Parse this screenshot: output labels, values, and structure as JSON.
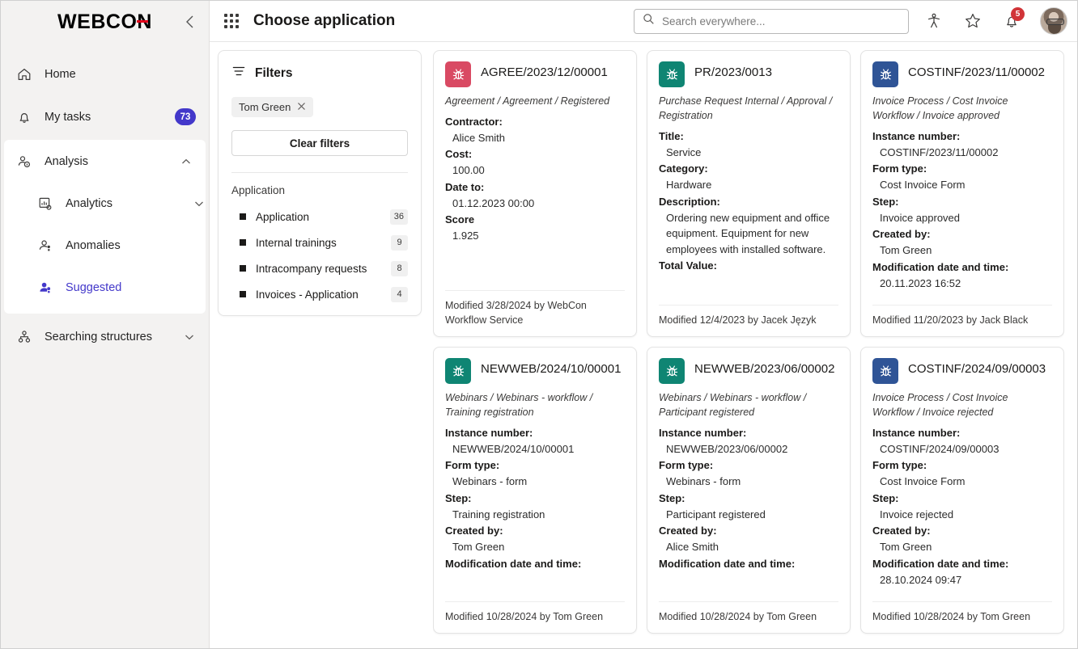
{
  "sidebar": {
    "logo": {
      "part1": "WEBC",
      "part2": "O",
      "part3": "N"
    },
    "collapse_label": "<",
    "items": [
      {
        "label": "Home",
        "icon": "home-icon"
      },
      {
        "label": "My tasks",
        "icon": "bell-icon",
        "badge": "73"
      }
    ],
    "group": {
      "label": "Analysis",
      "icon": "person-info-icon",
      "sub_items": [
        {
          "label": "Analytics",
          "icon": "analytics-icon",
          "expandable": true
        },
        {
          "label": "Anomalies",
          "icon": "person-alert-icon",
          "expandable": false
        },
        {
          "label": "Suggested",
          "icon": "people-suggest-icon",
          "expandable": false,
          "active": true
        }
      ]
    },
    "bottom_item": {
      "label": "Searching structures",
      "icon": "org-tree-icon"
    }
  },
  "topbar": {
    "title": "Choose application",
    "search": {
      "placeholder": "Search everywhere...",
      "value": ""
    },
    "notification_count": "5"
  },
  "filters": {
    "title": "Filters",
    "chips": [
      {
        "label": "Tom Green"
      }
    ],
    "clear_label": "Clear filters",
    "group_label": "Application",
    "facets": [
      {
        "label": "Application",
        "count": "36"
      },
      {
        "label": "Internal trainings",
        "count": "9"
      },
      {
        "label": "Intracompany requests",
        "count": "8"
      },
      {
        "label": "Invoices - Application",
        "count": "4"
      }
    ]
  },
  "colors": {
    "icon_red": "#d94a63",
    "icon_teal": "#0f8573",
    "icon_blue": "#2f5496",
    "accent_purple": "#4338ca",
    "badge_red": "#d13438",
    "logo_red": "#e2001a"
  },
  "cards": [
    {
      "icon_color": "#d94a63",
      "icon_name": "bug-icon",
      "title": "AGREE/2023/12/00001",
      "path": "Agreement / Agreement / Registered",
      "fields": [
        {
          "label": "Contractor:",
          "value": "Alice Smith"
        },
        {
          "label": "Cost:",
          "value": "100.00"
        },
        {
          "label": "Date to:",
          "value": "01.12.2023 00:00"
        },
        {
          "label": "Score",
          "value": "1.925"
        }
      ],
      "footer": "Modified 3/28/2024 by WebCon Workflow Service"
    },
    {
      "icon_color": "#0f8573",
      "icon_name": "bug-icon",
      "title": "PR/2023/0013",
      "path": "Purchase Request Internal / Approval / Registration",
      "fields": [
        {
          "label": "Title:",
          "value": "Service"
        },
        {
          "label": "Category:",
          "value": "Hardware"
        },
        {
          "label": "Description:",
          "value": "Ordering new equipment and office equipment. Equipment for new employees with installed software."
        },
        {
          "label": "Total Value:",
          "value": ""
        }
      ],
      "footer": "Modified 12/4/2023 by Jacek Język"
    },
    {
      "icon_color": "#2f5496",
      "icon_name": "bug-icon",
      "title": "COSTINF/2023/11/00002",
      "path": "Invoice Process / Cost Invoice Workflow / Invoice approved",
      "fields": [
        {
          "label": "Instance number:",
          "value": "COSTINF/2023/11/00002"
        },
        {
          "label": "Form type:",
          "value": "Cost Invoice Form"
        },
        {
          "label": "Step:",
          "value": "Invoice approved"
        },
        {
          "label": "Created by:",
          "value": "Tom Green"
        },
        {
          "label": "Modification date and time:",
          "value": "20.11.2023 16:52"
        }
      ],
      "footer": "Modified 11/20/2023 by Jack Black"
    },
    {
      "icon_color": "#0f8573",
      "icon_name": "bug-icon",
      "title": "NEWWEB/2024/10/00001",
      "path": "Webinars / Webinars - workflow / Training registration",
      "fields": [
        {
          "label": "Instance number:",
          "value": "NEWWEB/2024/10/00001"
        },
        {
          "label": "Form type:",
          "value": "Webinars - form"
        },
        {
          "label": "Step:",
          "value": "Training registration"
        },
        {
          "label": "Created by:",
          "value": "Tom Green"
        },
        {
          "label": "Modification date and time:",
          "value": ""
        }
      ],
      "footer": "Modified 10/28/2024 by Tom Green"
    },
    {
      "icon_color": "#0f8573",
      "icon_name": "bug-icon",
      "title": "NEWWEB/2023/06/00002",
      "path": "Webinars / Webinars - workflow / Participant registered",
      "fields": [
        {
          "label": "Instance number:",
          "value": "NEWWEB/2023/06/00002"
        },
        {
          "label": "Form type:",
          "value": "Webinars - form"
        },
        {
          "label": "Step:",
          "value": "Participant registered"
        },
        {
          "label": "Created by:",
          "value": "Alice Smith"
        },
        {
          "label": "Modification date and time:",
          "value": ""
        }
      ],
      "footer": "Modified 10/28/2024 by Tom Green"
    },
    {
      "icon_color": "#2f5496",
      "icon_name": "bug-icon",
      "title": "COSTINF/2024/09/00003",
      "path": "Invoice Process / Cost Invoice Workflow / Invoice rejected",
      "fields": [
        {
          "label": "Instance number:",
          "value": "COSTINF/2024/09/00003"
        },
        {
          "label": "Form type:",
          "value": "Cost Invoice Form"
        },
        {
          "label": "Step:",
          "value": "Invoice rejected"
        },
        {
          "label": "Created by:",
          "value": "Tom Green"
        },
        {
          "label": "Modification date and time:",
          "value": "28.10.2024 09:47"
        }
      ],
      "footer": "Modified 10/28/2024 by Tom Green"
    }
  ]
}
